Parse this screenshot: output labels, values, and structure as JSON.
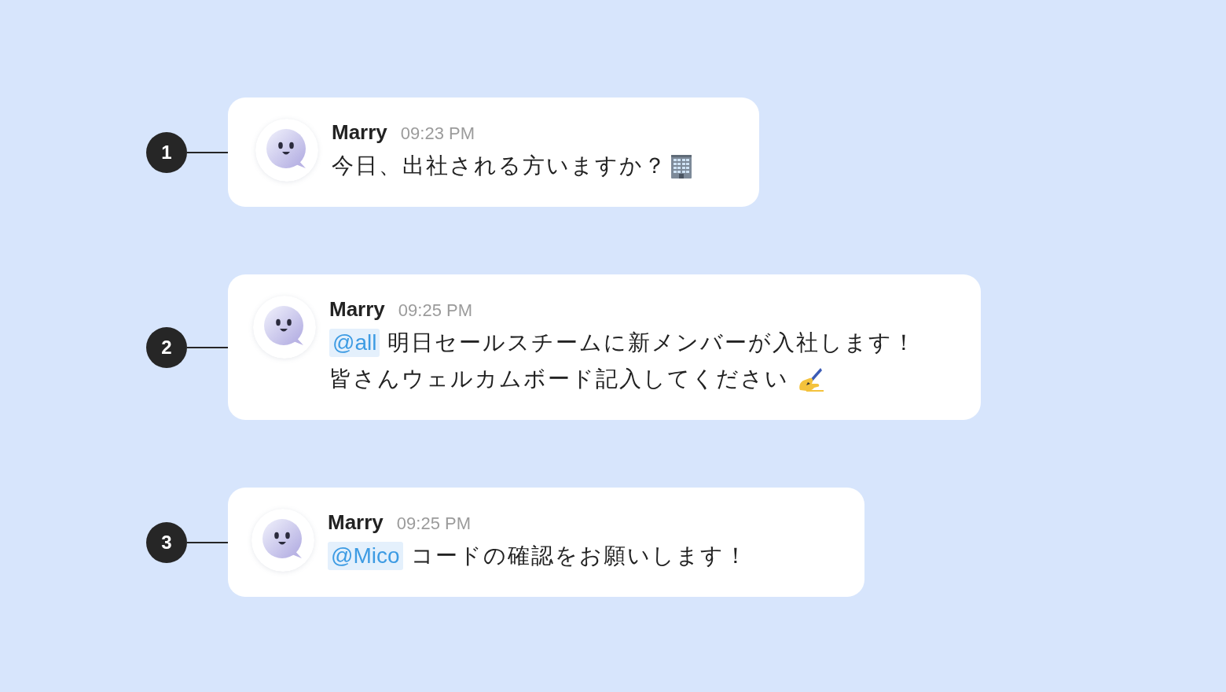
{
  "messages": [
    {
      "number": "1",
      "author": "Marry",
      "time": "09:23 PM",
      "lines": [
        "今日、出社される方いますか？"
      ],
      "emoji": {
        "kind": "building"
      }
    },
    {
      "number": "2",
      "author": "Marry",
      "time": "09:25 PM",
      "mention": "@all",
      "lines": [
        "明日セールスチームに新メンバーが入社します！",
        "皆さんウェルカムボード記入してください"
      ],
      "emoji": {
        "kind": "hand"
      }
    },
    {
      "number": "3",
      "author": "Marry",
      "time": "09:25 PM",
      "mention": "@Mico",
      "lines": [
        "コードの確認をお願いします！"
      ]
    }
  ]
}
